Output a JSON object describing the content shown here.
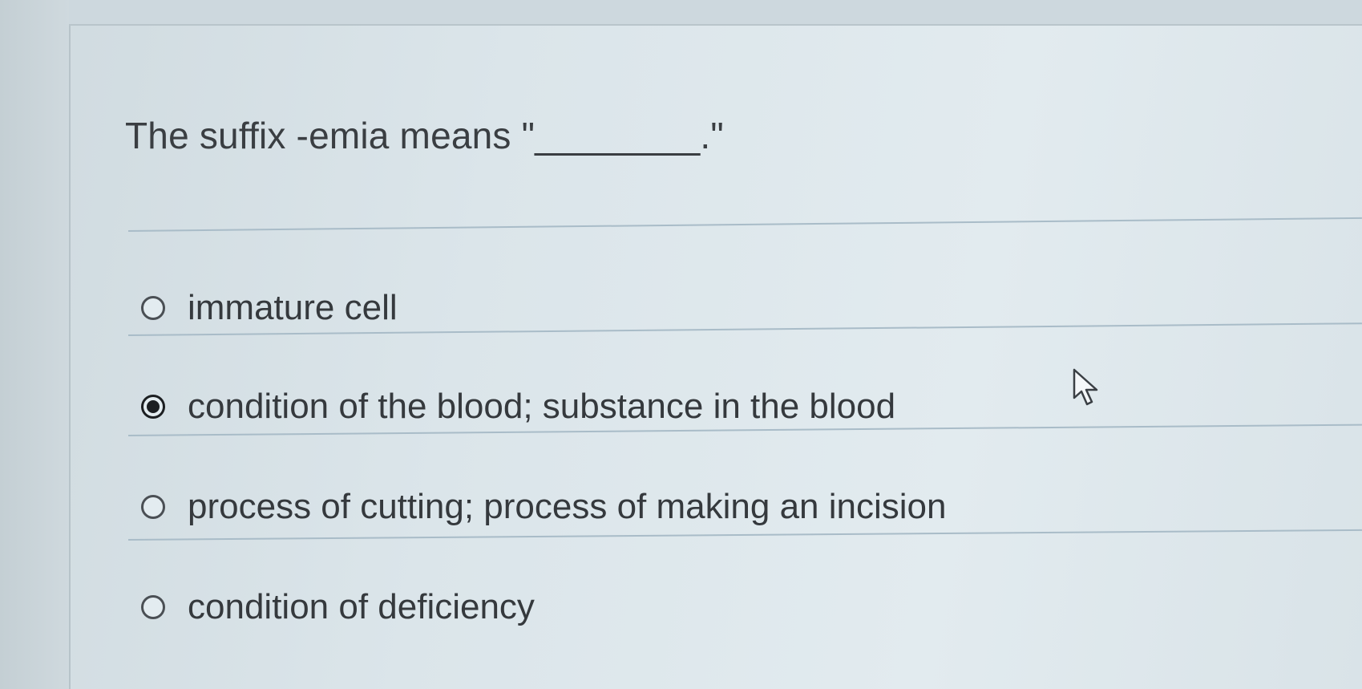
{
  "question": {
    "text": "The suffix -emia means \"________.\""
  },
  "options": [
    {
      "label": "immature cell",
      "selected": false
    },
    {
      "label": "condition of the blood; substance in the blood",
      "selected": true
    },
    {
      "label": "process of cutting; process of making an incision",
      "selected": false
    },
    {
      "label": "condition of deficiency",
      "selected": false
    }
  ],
  "icons": {
    "cursor": "arrow-pointer-icon",
    "radio": "radio-button-icon"
  },
  "colors": {
    "background": "#dbe5ea",
    "text": "#35393d",
    "divider": "#a9bcc8",
    "radio_selected": "#1c1f22"
  }
}
